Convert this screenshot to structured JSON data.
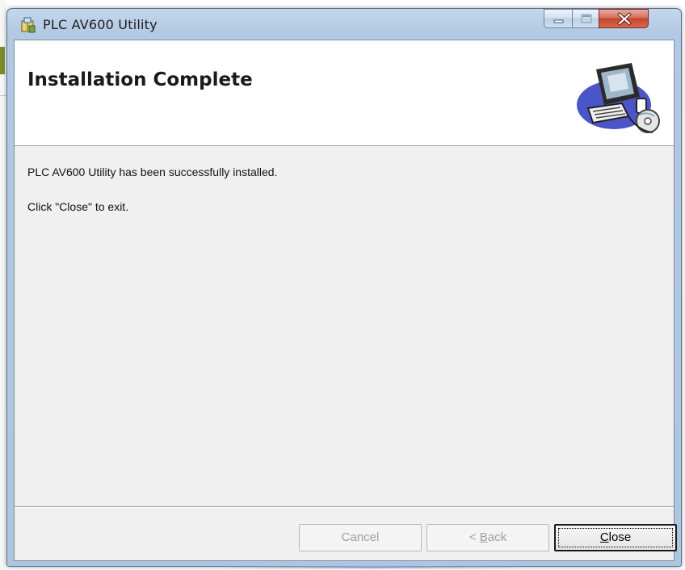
{
  "window": {
    "title": "PLC AV600 Utility",
    "controls": [
      "minimize",
      "maximize",
      "close"
    ]
  },
  "banner": {
    "title": "Installation Complete",
    "image": "computer-install-clipart"
  },
  "messages": {
    "line1": "PLC AV600 Utility has been successfully installed.",
    "line2": "Click \"Close\" to exit."
  },
  "buttons": {
    "cancel": "Cancel",
    "back_prefix": "< ",
    "back_accel": "B",
    "back_rest": "ack",
    "close_accel": "C",
    "close_rest": "lose"
  },
  "colors": {
    "frame": "#b3c9e3",
    "close_button": "#c4452d",
    "client": "#f0f0f0"
  }
}
